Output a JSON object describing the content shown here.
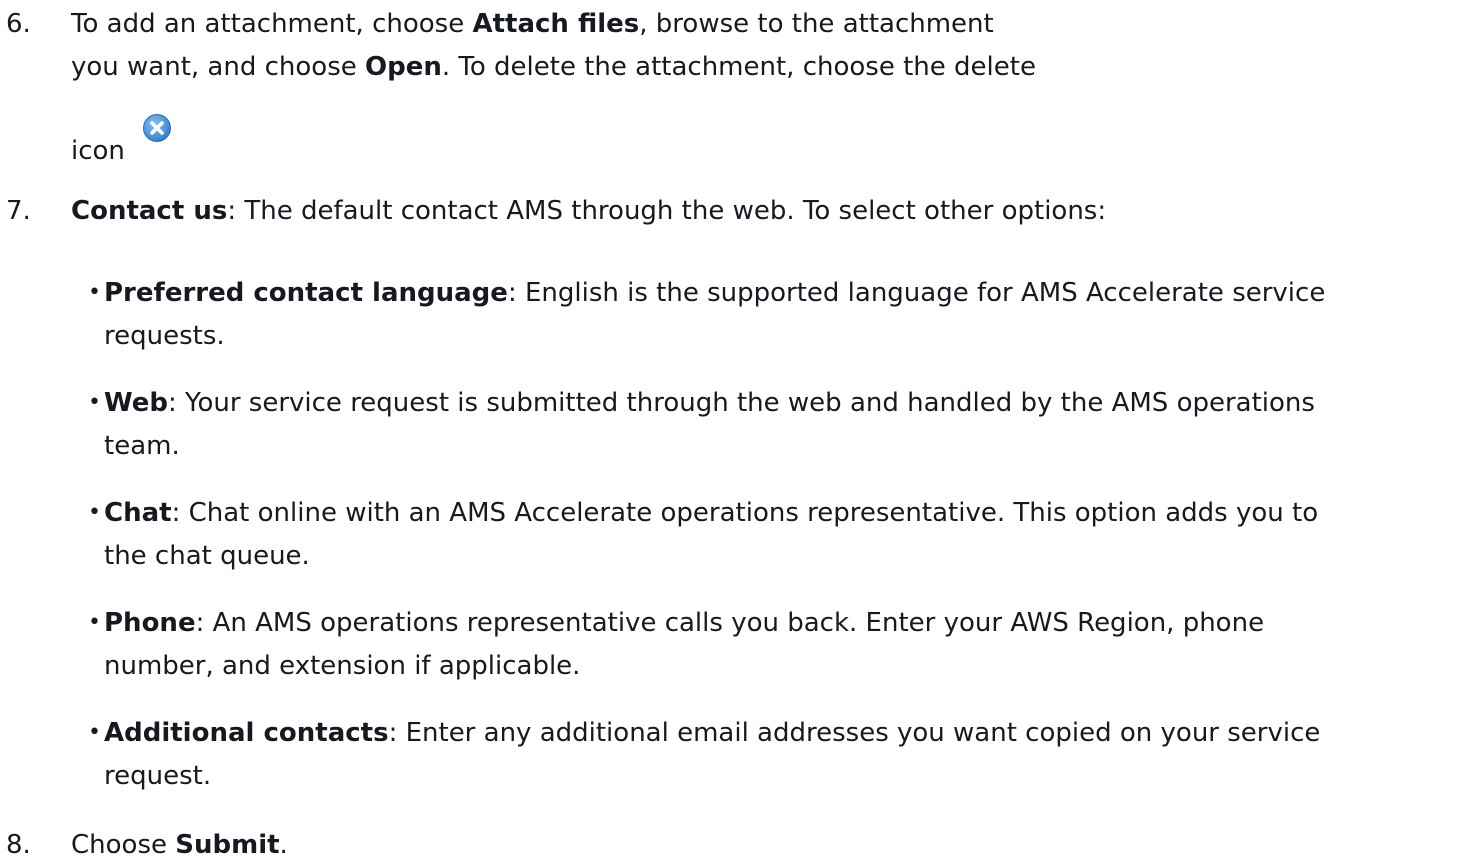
{
  "steps": [
    {
      "number": "6.",
      "line1_pre": "To add an attachment, choose ",
      "line1_bold": "Attach files",
      "line1_post": ", browse to the attachment",
      "line2_pre": "you want, and choose ",
      "line2_bold": "Open",
      "line2_post": ". To delete the attachment, choose the delete",
      "line3": "icon",
      "icon": "delete-circle-x-icon",
      "icon_color": "#4a90d9"
    },
    {
      "number": "7.",
      "lead_bold": "Contact us",
      "lead_text": ": The default contact AMS through the web. To select other options:",
      "bullets": [
        {
          "bold": "Preferred contact language",
          "line1": ": English is the supported language for AMS Accelerate service",
          "line2": "requests."
        },
        {
          "bold": "Web",
          "line1": ": Your service request is submitted through the web and handled by the AMS operations",
          "line2": "team."
        },
        {
          "bold": "Chat",
          "line1": ": Chat online with an AMS Accelerate operations representative. This option adds you to",
          "line2": "the chat queue."
        },
        {
          "bold": "Phone",
          "line1": ": An AMS operations representative calls you back. Enter your AWS Region, phone",
          "line2": "number, and extension if applicable."
        },
        {
          "bold": "Additional contacts",
          "line1": ": Enter any additional email addresses you want copied on your service",
          "line2": "request."
        }
      ]
    },
    {
      "number": "8.",
      "pre": "Choose ",
      "bold": "Submit",
      "post": "."
    }
  ],
  "bullet_glyph": "•"
}
